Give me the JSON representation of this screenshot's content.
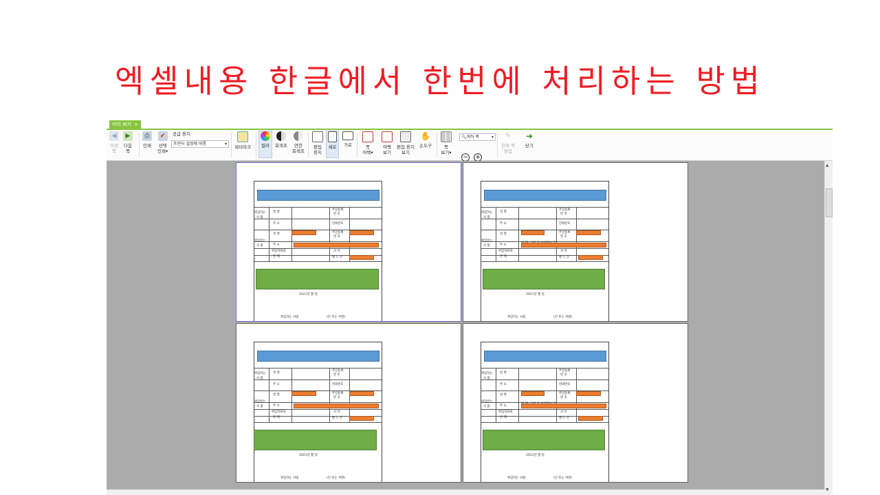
{
  "slide_title": "엑셀내용 한글에서 한번에 처리하는 방법",
  "tab": {
    "label": "미리 보기",
    "close": "×"
  },
  "toolbar": {
    "prev_page": [
      "이전",
      "쪽"
    ],
    "next_page": [
      "다음",
      "쪽"
    ],
    "print": "인쇄",
    "select_print": [
      "선택",
      "인쇄▾"
    ],
    "paper_label": "공급 용지",
    "paper_value": "프린터 설정에 따름",
    "watermark": "워터마크",
    "color": "컬러",
    "grayscale": "회색조",
    "light_gray": [
      "연한",
      "회색조"
    ],
    "edit_paper": [
      "편집",
      "용지"
    ],
    "portrait": "세로",
    "landscape": "가로",
    "page_margin": [
      "쪽",
      "여백▾"
    ],
    "margin_view": [
      "여백",
      "보기"
    ],
    "edit_paper_view": [
      "편집 용지",
      "보기"
    ],
    "hand_tool": "손도구",
    "page_view": [
      "쪽",
      "보기▾"
    ],
    "zoom_value": "여러 쪽",
    "zoom_out": "−",
    "zoom_in": "+",
    "current_page_edit": [
      "현재 쪽",
      "편집"
    ],
    "close": "닫기"
  },
  "form": {
    "left_rows": [
      "위임하는",
      "사    람",
      "위임받는",
      "사    람"
    ],
    "name": "성        명",
    "address": "주        소",
    "relation": [
      "위임자와의",
      "관        계"
    ],
    "ssn": [
      "주민등록",
      "번    호"
    ],
    "phone": "전화번호",
    "reason": "사    유",
    "signature": "밴 드 은",
    "date": "2021년     월     일",
    "footer_left": "위임하는 사람",
    "footer_right": "(인 또는 서명)",
    "stray_text": "위 해 - 2년 의 보유정보 및"
  }
}
